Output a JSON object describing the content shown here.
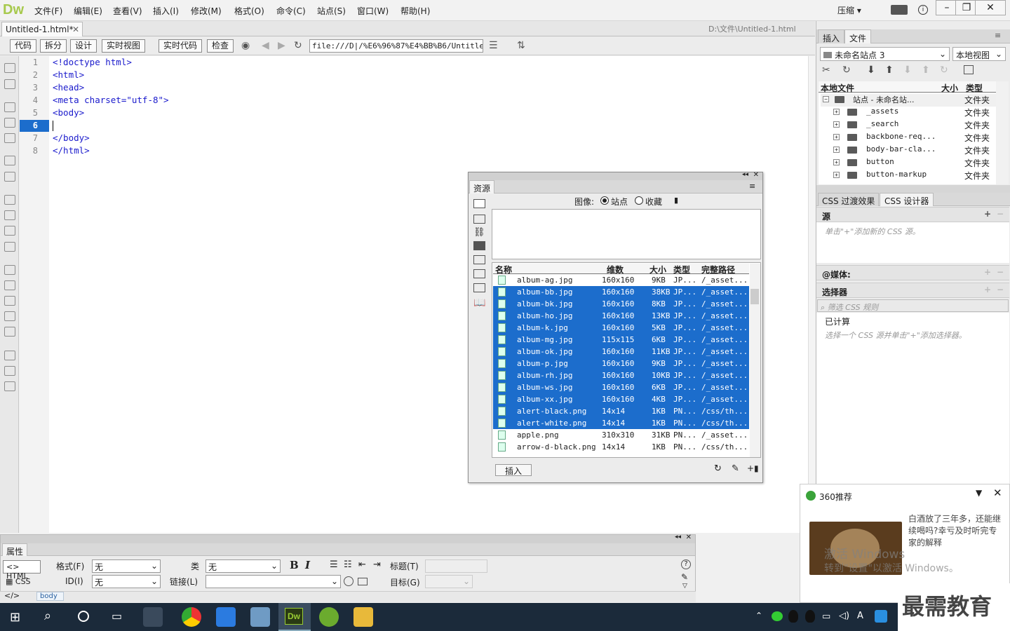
{
  "app": {
    "logo": "Dw"
  },
  "menu": [
    "文件(F)",
    "编辑(E)",
    "查看(V)",
    "插入(I)",
    "修改(M)",
    "格式(O)",
    "命令(C)",
    "站点(S)",
    "窗口(W)",
    "帮助(H)"
  ],
  "menu_right": {
    "compress": "压缩 ▾"
  },
  "document": {
    "tab": "Untitled-1.html*",
    "path": "D:\\文件\\Untitled-1.html"
  },
  "toolbar": {
    "code": "代码",
    "split": "拆分",
    "design": "设计",
    "live_view": "实时视图",
    "live_code": "实时代码",
    "inspect": "检查",
    "url": "file:///D|/%E6%96%87%E4%BB%B6/Untitled"
  },
  "code_lines": [
    "<!doctype html>",
    "<html>",
    "<head>",
    "<meta charset=\"utf-8\">",
    "<body>",
    "",
    "</body>",
    "</html>"
  ],
  "line_numbers": [
    "1",
    "2",
    "3",
    "4",
    "5",
    "6",
    "7",
    "8"
  ],
  "files_panel": {
    "tabs": [
      "插入",
      "文件"
    ],
    "site": "未命名站点 3",
    "view": "本地视图",
    "col_local": "本地文件",
    "col_size": "大小",
    "col_type": "类型",
    "root": {
      "name": "站点 - 未命名站...",
      "type": "文件夹"
    },
    "items": [
      {
        "name": "_assets",
        "type": "文件夹"
      },
      {
        "name": "_search",
        "type": "文件夹"
      },
      {
        "name": "backbone-req...",
        "type": "文件夹"
      },
      {
        "name": "body-bar-cla...",
        "type": "文件夹"
      },
      {
        "name": "button",
        "type": "文件夹"
      },
      {
        "name": "button-markup",
        "type": "文件夹"
      }
    ]
  },
  "css_panel": {
    "tabs": [
      "CSS 过渡效果",
      "CSS 设计器"
    ],
    "source": "源",
    "source_hint": "单击\"+\"添加新的 CSS 源。",
    "media": "@媒体:",
    "selector": "选择器",
    "filter_placeholder": "筛选 CSS 规则",
    "computed": "已计算",
    "computed_hint": "选择一个 CSS 源并单击\"+\"添加选择器。"
  },
  "assets": {
    "title": "资源",
    "image_label": "图像:",
    "opt_site": "站点",
    "opt_fav": "收藏",
    "cols": [
      "名称",
      "维数",
      "大小",
      "类型",
      "完整路径"
    ],
    "rows": [
      {
        "name": "album-ag.jpg",
        "dim": "160x160",
        "size": "9KB",
        "type": "JP...",
        "path": "/_asset...",
        "sel": false
      },
      {
        "name": "album-bb.jpg",
        "dim": "160x160",
        "size": "38KB",
        "type": "JP...",
        "path": "/_asset...",
        "sel": true
      },
      {
        "name": "album-bk.jpg",
        "dim": "160x160",
        "size": "8KB",
        "type": "JP...",
        "path": "/_asset...",
        "sel": true
      },
      {
        "name": "album-ho.jpg",
        "dim": "160x160",
        "size": "13KB",
        "type": "JP...",
        "path": "/_asset...",
        "sel": true
      },
      {
        "name": "album-k.jpg",
        "dim": "160x160",
        "size": "5KB",
        "type": "JP...",
        "path": "/_asset...",
        "sel": true
      },
      {
        "name": "album-mg.jpg",
        "dim": "115x115",
        "size": "6KB",
        "type": "JP...",
        "path": "/_asset...",
        "sel": true
      },
      {
        "name": "album-ok.jpg",
        "dim": "160x160",
        "size": "11KB",
        "type": "JP...",
        "path": "/_asset...",
        "sel": true
      },
      {
        "name": "album-p.jpg",
        "dim": "160x160",
        "size": "9KB",
        "type": "JP...",
        "path": "/_asset...",
        "sel": true
      },
      {
        "name": "album-rh.jpg",
        "dim": "160x160",
        "size": "10KB",
        "type": "JP...",
        "path": "/_asset...",
        "sel": true
      },
      {
        "name": "album-ws.jpg",
        "dim": "160x160",
        "size": "6KB",
        "type": "JP...",
        "path": "/_asset...",
        "sel": true
      },
      {
        "name": "album-xx.jpg",
        "dim": "160x160",
        "size": "4KB",
        "type": "JP...",
        "path": "/_asset...",
        "sel": true
      },
      {
        "name": "alert-black.png",
        "dim": "14x14",
        "size": "1KB",
        "type": "PN...",
        "path": "/css/th...",
        "sel": true
      },
      {
        "name": "alert-white.png",
        "dim": "14x14",
        "size": "1KB",
        "type": "PN...",
        "path": "/css/th...",
        "sel": true
      },
      {
        "name": "apple.png",
        "dim": "310x310",
        "size": "31KB",
        "type": "PN...",
        "path": "/_asset...",
        "sel": false
      },
      {
        "name": "arrow-d-black.png",
        "dim": "14x14",
        "size": "1KB",
        "type": "PN...",
        "path": "/css/th...",
        "sel": false
      }
    ],
    "insert": "插入"
  },
  "properties": {
    "title": "属性",
    "html": "HTML",
    "css": "CSS",
    "format_label": "格式(F)",
    "format_val": "无",
    "class_label": "类",
    "class_val": "无",
    "id_label": "ID(I)",
    "id_val": "无",
    "link_label": "链接(L)",
    "title_label": "标题(T)",
    "target_label": "目标(G)"
  },
  "status": {
    "tag": "body"
  },
  "popup": {
    "title": "360推荐",
    "text": "白酒放了三年多，还能继续喝吗?幸亏及时听完专家的解释",
    "watermark1": "激活 Windows",
    "watermark2": "转到\"设置\"以激活 Windows。"
  },
  "brand": "最需教育"
}
